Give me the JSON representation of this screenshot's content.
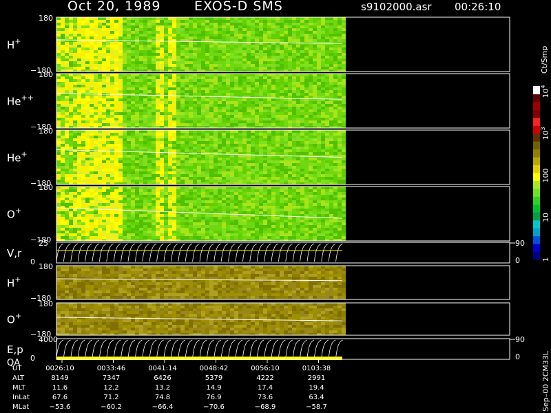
{
  "header": {
    "date": "Oct 20, 1989",
    "instrument": "EXOS-D SMS",
    "filename": "s9102000.asr",
    "time": "00:26:10"
  },
  "colorbar": {
    "unit_label": "Ct/Smp",
    "ticks": [
      {
        "value": 10000,
        "label": "10",
        "sup": "4"
      },
      {
        "value": 1000,
        "label": "10",
        "sup": "3"
      },
      {
        "value": 100,
        "label": "100",
        "sup": ""
      },
      {
        "value": 10,
        "label": "10",
        "sup": ""
      },
      {
        "value": 1,
        "label": "1",
        "sup": ""
      }
    ],
    "colors": [
      "#000080",
      "#0000c8",
      "#0050e0",
      "#00a0c8",
      "#00c8c8",
      "#00a040",
      "#00c030",
      "#30d020",
      "#70e020",
      "#a8e820",
      "#ffff00",
      "#e0d000",
      "#b8a800",
      "#908000",
      "#706000",
      "#603000",
      "#d00000",
      "#ff2020",
      "#800000",
      "#a00000",
      "#600000",
      "#ffffff"
    ]
  },
  "side_text": "Sep–00 2CM33L",
  "footer": {
    "labels": [
      "UT",
      "ALT",
      "MLT",
      "InLat",
      "MLat"
    ],
    "columns": [
      {
        "UT": "0026:10",
        "ALT": "8149",
        "MLT": "11.6",
        "InLat": "67.6",
        "MLat": "−53.6"
      },
      {
        "UT": "0033:46",
        "ALT": "7347",
        "MLT": "12.2",
        "InLat": "71.2",
        "MLat": "−60.2"
      },
      {
        "UT": "0041:14",
        "ALT": "6426",
        "MLT": "13.2",
        "InLat": "74.8",
        "MLat": "−66.4"
      },
      {
        "UT": "0048:42",
        "ALT": "5379",
        "MLT": "14.9",
        "InLat": "76.9",
        "MLat": "−70.6"
      },
      {
        "UT": "0056:10",
        "ALT": "4222",
        "MLT": "17.4",
        "InLat": "73.6",
        "MLat": "−68.9"
      },
      {
        "UT": "0103:38",
        "ALT": "2991",
        "MLT": "19.4",
        "InLat": "63.4",
        "MLat": "−58.7"
      }
    ]
  },
  "chart_data": {
    "type": "heatmap",
    "x_ticks": [
      "0026:10",
      "0033:46",
      "0041:14",
      "0048:42",
      "0056:10",
      "0103:38"
    ],
    "x_range_ut": [
      "0026:10",
      "0103:38"
    ],
    "panels": [
      {
        "label": "H",
        "sup": "+",
        "ylim": [
          -180,
          180
        ],
        "tick_top": "180",
        "tick_bottom": "−180",
        "palette": "green",
        "trend": [
          30,
          6
        ]
      },
      {
        "label": "He",
        "sup": "++",
        "ylim": [
          -180,
          180
        ],
        "tick_top": "180",
        "tick_bottom": "−180",
        "palette": "green",
        "trend": [
          50,
          10
        ]
      },
      {
        "label": "He",
        "sup": "+",
        "ylim": [
          -180,
          180
        ],
        "tick_top": "180",
        "tick_bottom": "−180",
        "palette": "green",
        "trend": [
          50,
          0
        ]
      },
      {
        "label": "O",
        "sup": "+",
        "ylim": [
          -180,
          180
        ],
        "tick_top": "180",
        "tick_bottom": "−180",
        "palette": "green",
        "trend": [
          40,
          -30
        ]
      },
      {
        "label": "V,r",
        "sup": "",
        "ylim": [
          0,
          25
        ],
        "tick_top": "25",
        "tick_bottom": "0",
        "right_top": "90",
        "right_bottom": "0",
        "palette": "line"
      },
      {
        "label": "H",
        "sup": "+",
        "ylim": [
          -180,
          180
        ],
        "tick_top": "180",
        "tick_bottom": "−180",
        "palette": "olive",
        "trend": [
          40,
          20
        ]
      },
      {
        "label": "O",
        "sup": "+",
        "ylim": [
          -180,
          180
        ],
        "tick_top": "180",
        "tick_bottom": "−180",
        "palette": "olive",
        "trend": [
          20,
          -20
        ]
      },
      {
        "label": "E,p",
        "label2": "QA",
        "sup": "",
        "ylim": [
          0,
          4000
        ],
        "tick_top": "4000",
        "tick_bottom": "0",
        "right_top": "90",
        "right_bottom": "0",
        "palette": "line"
      }
    ]
  }
}
